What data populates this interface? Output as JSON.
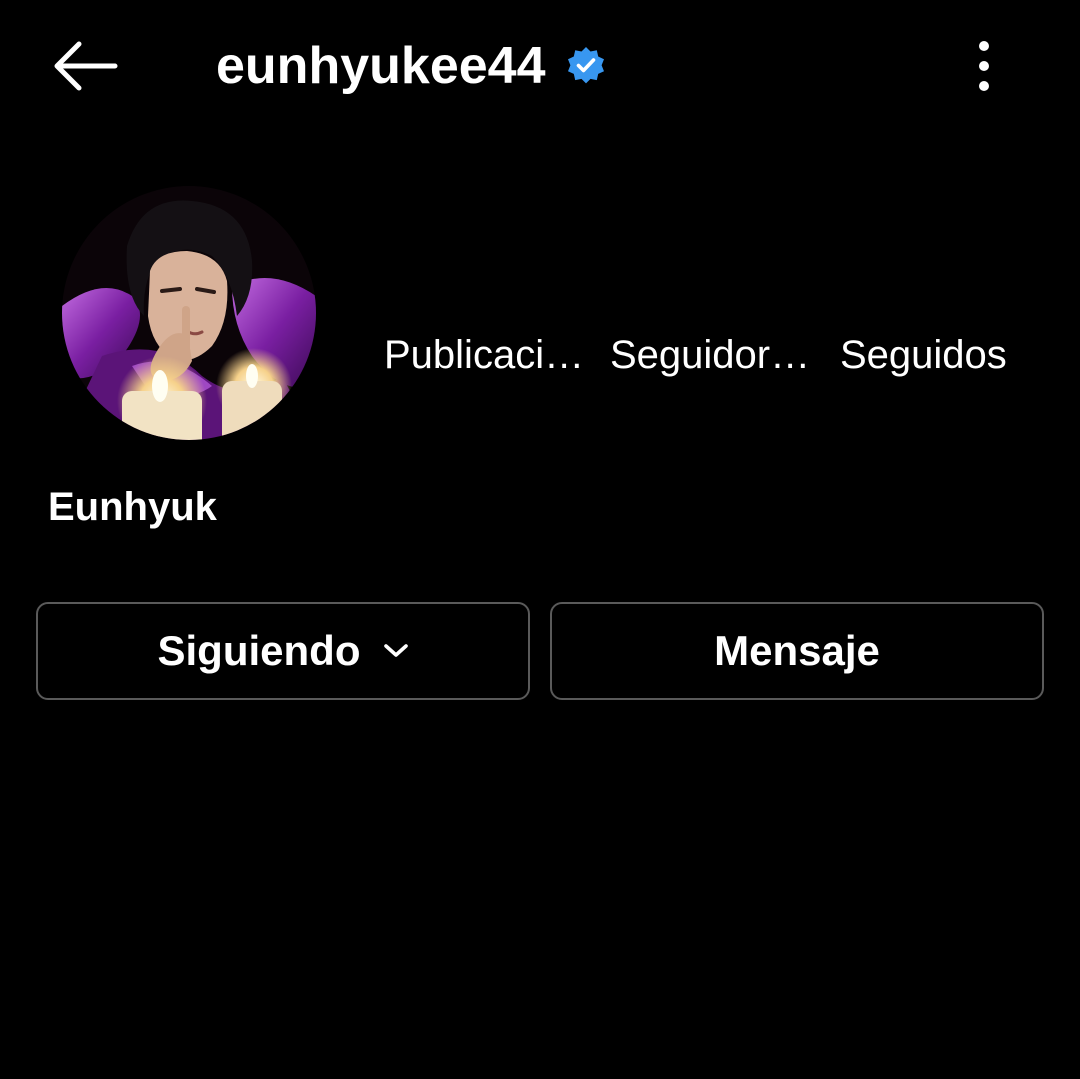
{
  "header": {
    "username": "eunhyukee44",
    "icons": {
      "back": "back-arrow-icon",
      "verified": "verified-badge-icon",
      "more": "more-vertical-icon"
    },
    "verified_color": "#3897f0"
  },
  "profile": {
    "display_name": "Eunhyuk",
    "stats": [
      {
        "label": "Publicaci…"
      },
      {
        "label": "Seguidor…"
      },
      {
        "label": "Seguidos"
      }
    ]
  },
  "actions": {
    "follow_label": "Siguiendo",
    "message_label": "Mensaje",
    "follow_icon": "chevron-down-icon"
  },
  "colors": {
    "background": "#000000",
    "text": "#ffffff",
    "button_border": "#5a5a5a"
  }
}
